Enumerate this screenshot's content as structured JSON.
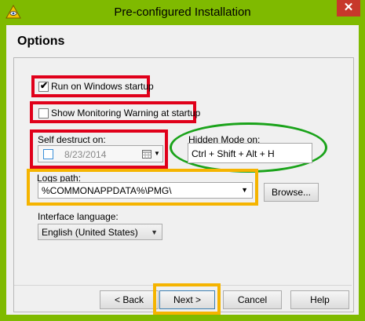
{
  "window": {
    "title": "Pre-configured Installation",
    "close_glyph": "✕"
  },
  "header": {
    "title": "Options"
  },
  "options": {
    "run_on_startup": {
      "label": "Run on Windows startup",
      "checked": true,
      "check_glyph": "✔"
    },
    "show_warning": {
      "label": "Show Monitoring Warning at startup",
      "checked": false
    },
    "self_destruct": {
      "label": "Self destruct on:",
      "date": "8/23/2014",
      "checked": false
    },
    "hidden_mode": {
      "label": "Hidden Mode on:",
      "hotkey": "Ctrl + Shift + Alt + H"
    },
    "logs_path": {
      "label": "Logs path:",
      "value": "%COMMONAPPDATA%\\PMG\\",
      "browse_label": "Browse..."
    },
    "language": {
      "label": "Interface language:",
      "value": "English (United States)"
    }
  },
  "footer": {
    "back_label": "< Back",
    "next_label": "Next >",
    "cancel_label": "Cancel",
    "help_label": "Help"
  },
  "colors": {
    "titlebar": "#7fba00",
    "annotation_red": "#e0001a",
    "annotation_orange": "#f5b400",
    "annotation_green": "#1aa31a",
    "close_button": "#c7382b"
  },
  "icons": {
    "app": "eye-pyramid-icon",
    "calendar": "calendar-icon",
    "dropdown": "chevron-down-icon",
    "close": "close-icon"
  }
}
